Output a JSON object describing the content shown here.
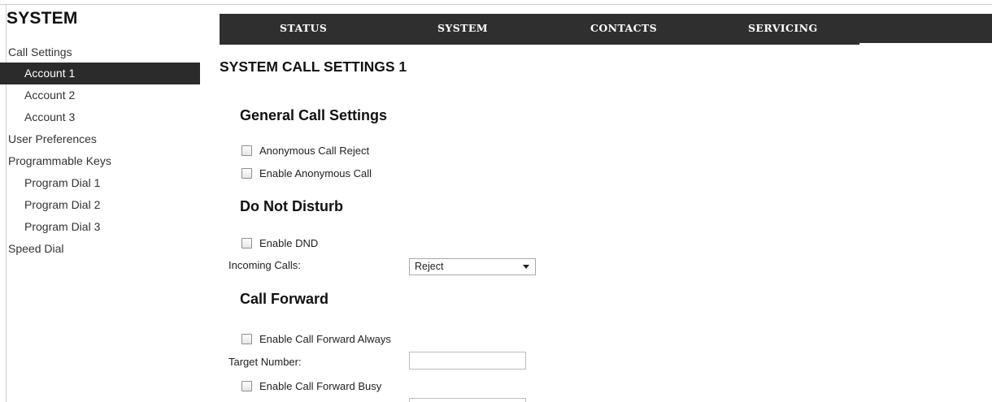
{
  "sidebar": {
    "title": "SYSTEM",
    "items": [
      {
        "label": "Call Settings"
      },
      {
        "label": "Account 1"
      },
      {
        "label": "Account 2"
      },
      {
        "label": "Account 3"
      },
      {
        "label": "User Preferences"
      },
      {
        "label": "Programmable Keys"
      },
      {
        "label": "Program Dial 1"
      },
      {
        "label": "Program Dial 2"
      },
      {
        "label": "Program Dial 3"
      },
      {
        "label": "Speed Dial"
      }
    ]
  },
  "topnav": {
    "tabs": [
      {
        "label": "STATUS"
      },
      {
        "label": "SYSTEM"
      },
      {
        "label": "CONTACTS"
      },
      {
        "label": "SERVICING"
      }
    ]
  },
  "main": {
    "page_title": "SYSTEM CALL SETTINGS 1",
    "general": {
      "title": "General Call Settings",
      "anonymous_reject": "Anonymous Call Reject",
      "enable_anonymous": "Enable Anonymous Call"
    },
    "dnd": {
      "title": "Do Not Disturb",
      "enable_dnd": "Enable DND",
      "incoming_label": "Incoming Calls:",
      "incoming_value": "Reject"
    },
    "forward": {
      "title": "Call Forward",
      "always": "Enable Call Forward Always",
      "target_label": "Target Number:",
      "target_value": "",
      "busy": "Enable Call Forward Busy"
    }
  },
  "colors": {
    "nav_bg": "#2f2f2f",
    "active_bg": "#2b2b2b",
    "active_text": "#ffffff"
  }
}
